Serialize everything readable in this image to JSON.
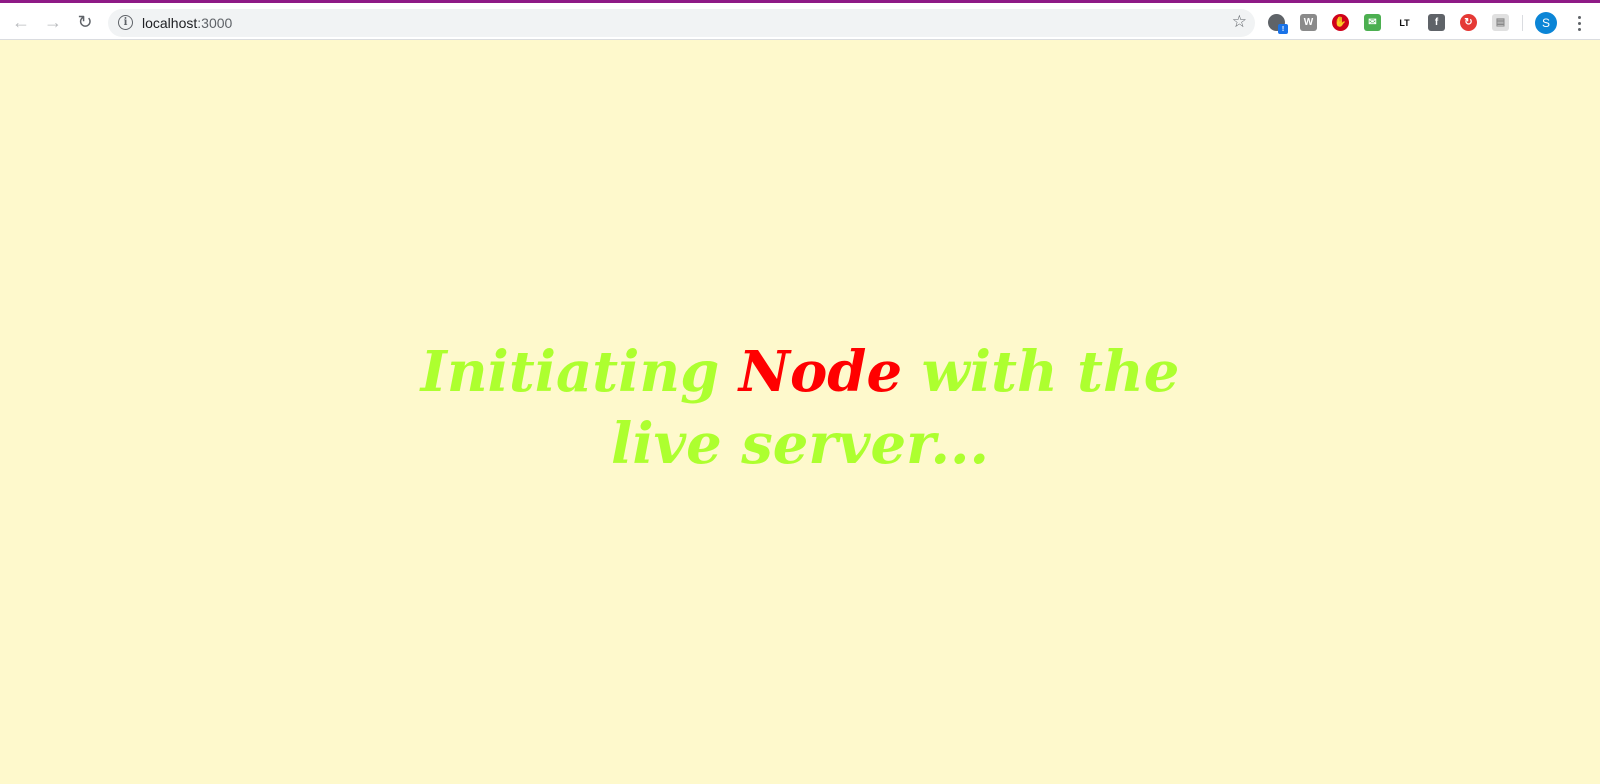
{
  "browser": {
    "url_host": "localhost",
    "url_port": ":3000",
    "profile_initial": "S"
  },
  "page": {
    "heading_part1": "Initiating ",
    "heading_accent": "Node",
    "heading_part2": " with the live server...",
    "colors": {
      "background": "#fef9cc",
      "heading": "#adff2f",
      "accent": "#ff0000"
    }
  },
  "icons": {
    "back": "arrow-left-icon",
    "forward": "arrow-right-icon",
    "reload": "reload-icon",
    "info": "info-icon",
    "bookmark": "star-icon",
    "menu": "kebab-menu-icon"
  }
}
